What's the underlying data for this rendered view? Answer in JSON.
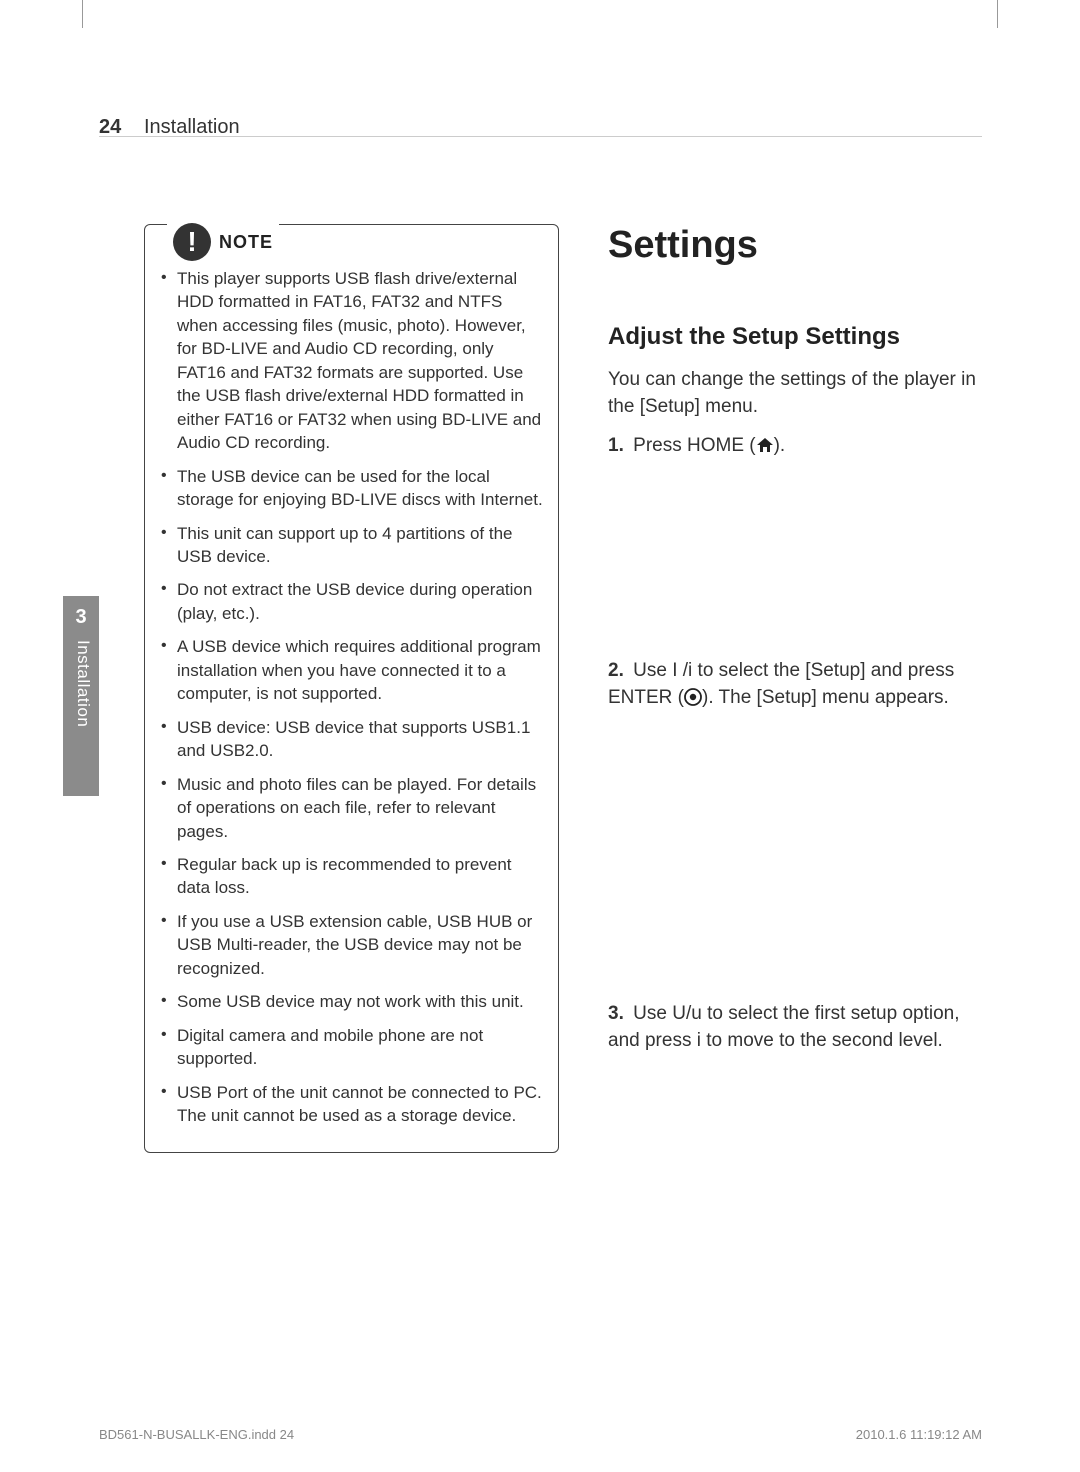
{
  "header": {
    "page_number": "24",
    "section": "Installation"
  },
  "side_tab": {
    "number": "3",
    "label": "Installation"
  },
  "note": {
    "badge_symbol": "!",
    "badge_label": "NOTE",
    "bullets": [
      "This player supports USB flash drive/external HDD formatted in FAT16, FAT32 and NTFS when accessing files (music, photo). However, for BD-LIVE and Audio CD recording, only FAT16 and FAT32 formats are supported. Use the USB flash drive/external HDD formatted in either FAT16 or FAT32 when using BD-LIVE and Audio CD recording.",
      "The USB device can be used for the local storage for enjoying BD-LIVE discs with Internet.",
      "This unit can support up to 4 partitions of the USB device.",
      "Do not extract the USB device during operation (play, etc.).",
      "A USB device which requires additional program installation when you have connected it to a computer, is not supported.",
      "USB device: USB device that supports USB1.1 and USB2.0.",
      "Music and photo files can be played. For details of operations on each file, refer to relevant pages.",
      "Regular back up is recommended to prevent data loss.",
      "If you use a USB extension cable, USB HUB or USB Multi-reader, the USB device may not be recognized.",
      "Some USB device may not work with this unit.",
      "Digital camera and mobile phone are not supported.",
      "USB Port of the unit cannot be connected to PC. The unit cannot be used as a storage device."
    ]
  },
  "right": {
    "h1": "Settings",
    "h2": "Adjust the Setup Settings",
    "intro": "You can change the settings of the player in the [Setup] menu.",
    "steps": {
      "s1_num": "1.",
      "s1_a": "Press HOME (",
      "s1_b": ").",
      "s2_num": "2.",
      "s2_a": "Use ",
      "s2_keys1": "I /i",
      "s2_b": " to select the [Setup] and press ENTER (",
      "s2_c": "). The [Setup] menu appears.",
      "s3_num": "3.",
      "s3_a": "Use ",
      "s3_keys1": "U/u",
      "s3_b": " to select the first setup option, and press ",
      "s3_keys2": "i",
      "s3_c": " to move to the second level."
    }
  },
  "footer": {
    "left": "BD561-N-BUSALLK-ENG.indd   24",
    "right": "2010.1.6   11:19:12 AM"
  }
}
